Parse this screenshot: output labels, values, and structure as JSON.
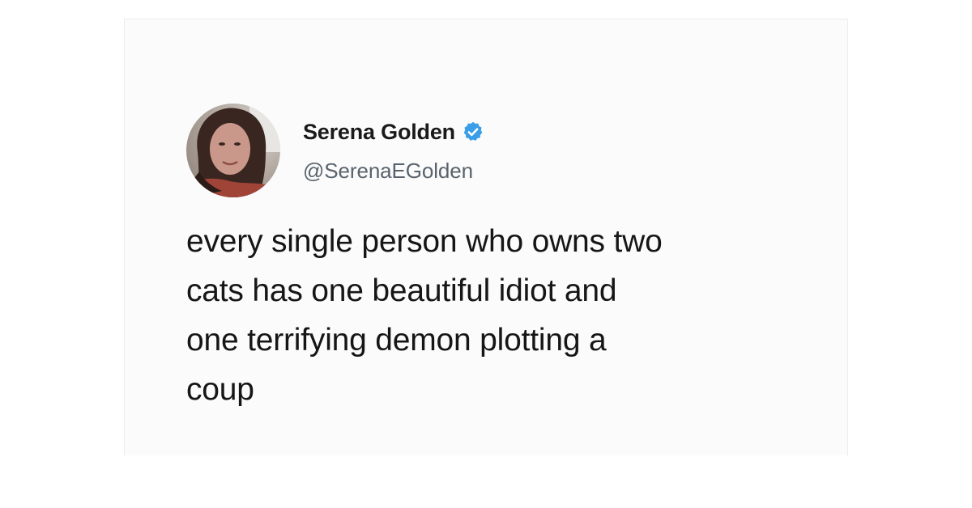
{
  "tweet": {
    "author_name": "Serena Golden",
    "author_handle": "@SerenaEGolden",
    "verified_icon": "verified-badge-icon",
    "text_lines": [
      "every single person who owns two",
      "cats has one beautiful idiot and",
      "one terrifying demon plotting a",
      "coup"
    ]
  },
  "colors": {
    "verified_blue": "#3b9ee8",
    "text_primary": "#161616",
    "text_secondary": "#59636d"
  }
}
